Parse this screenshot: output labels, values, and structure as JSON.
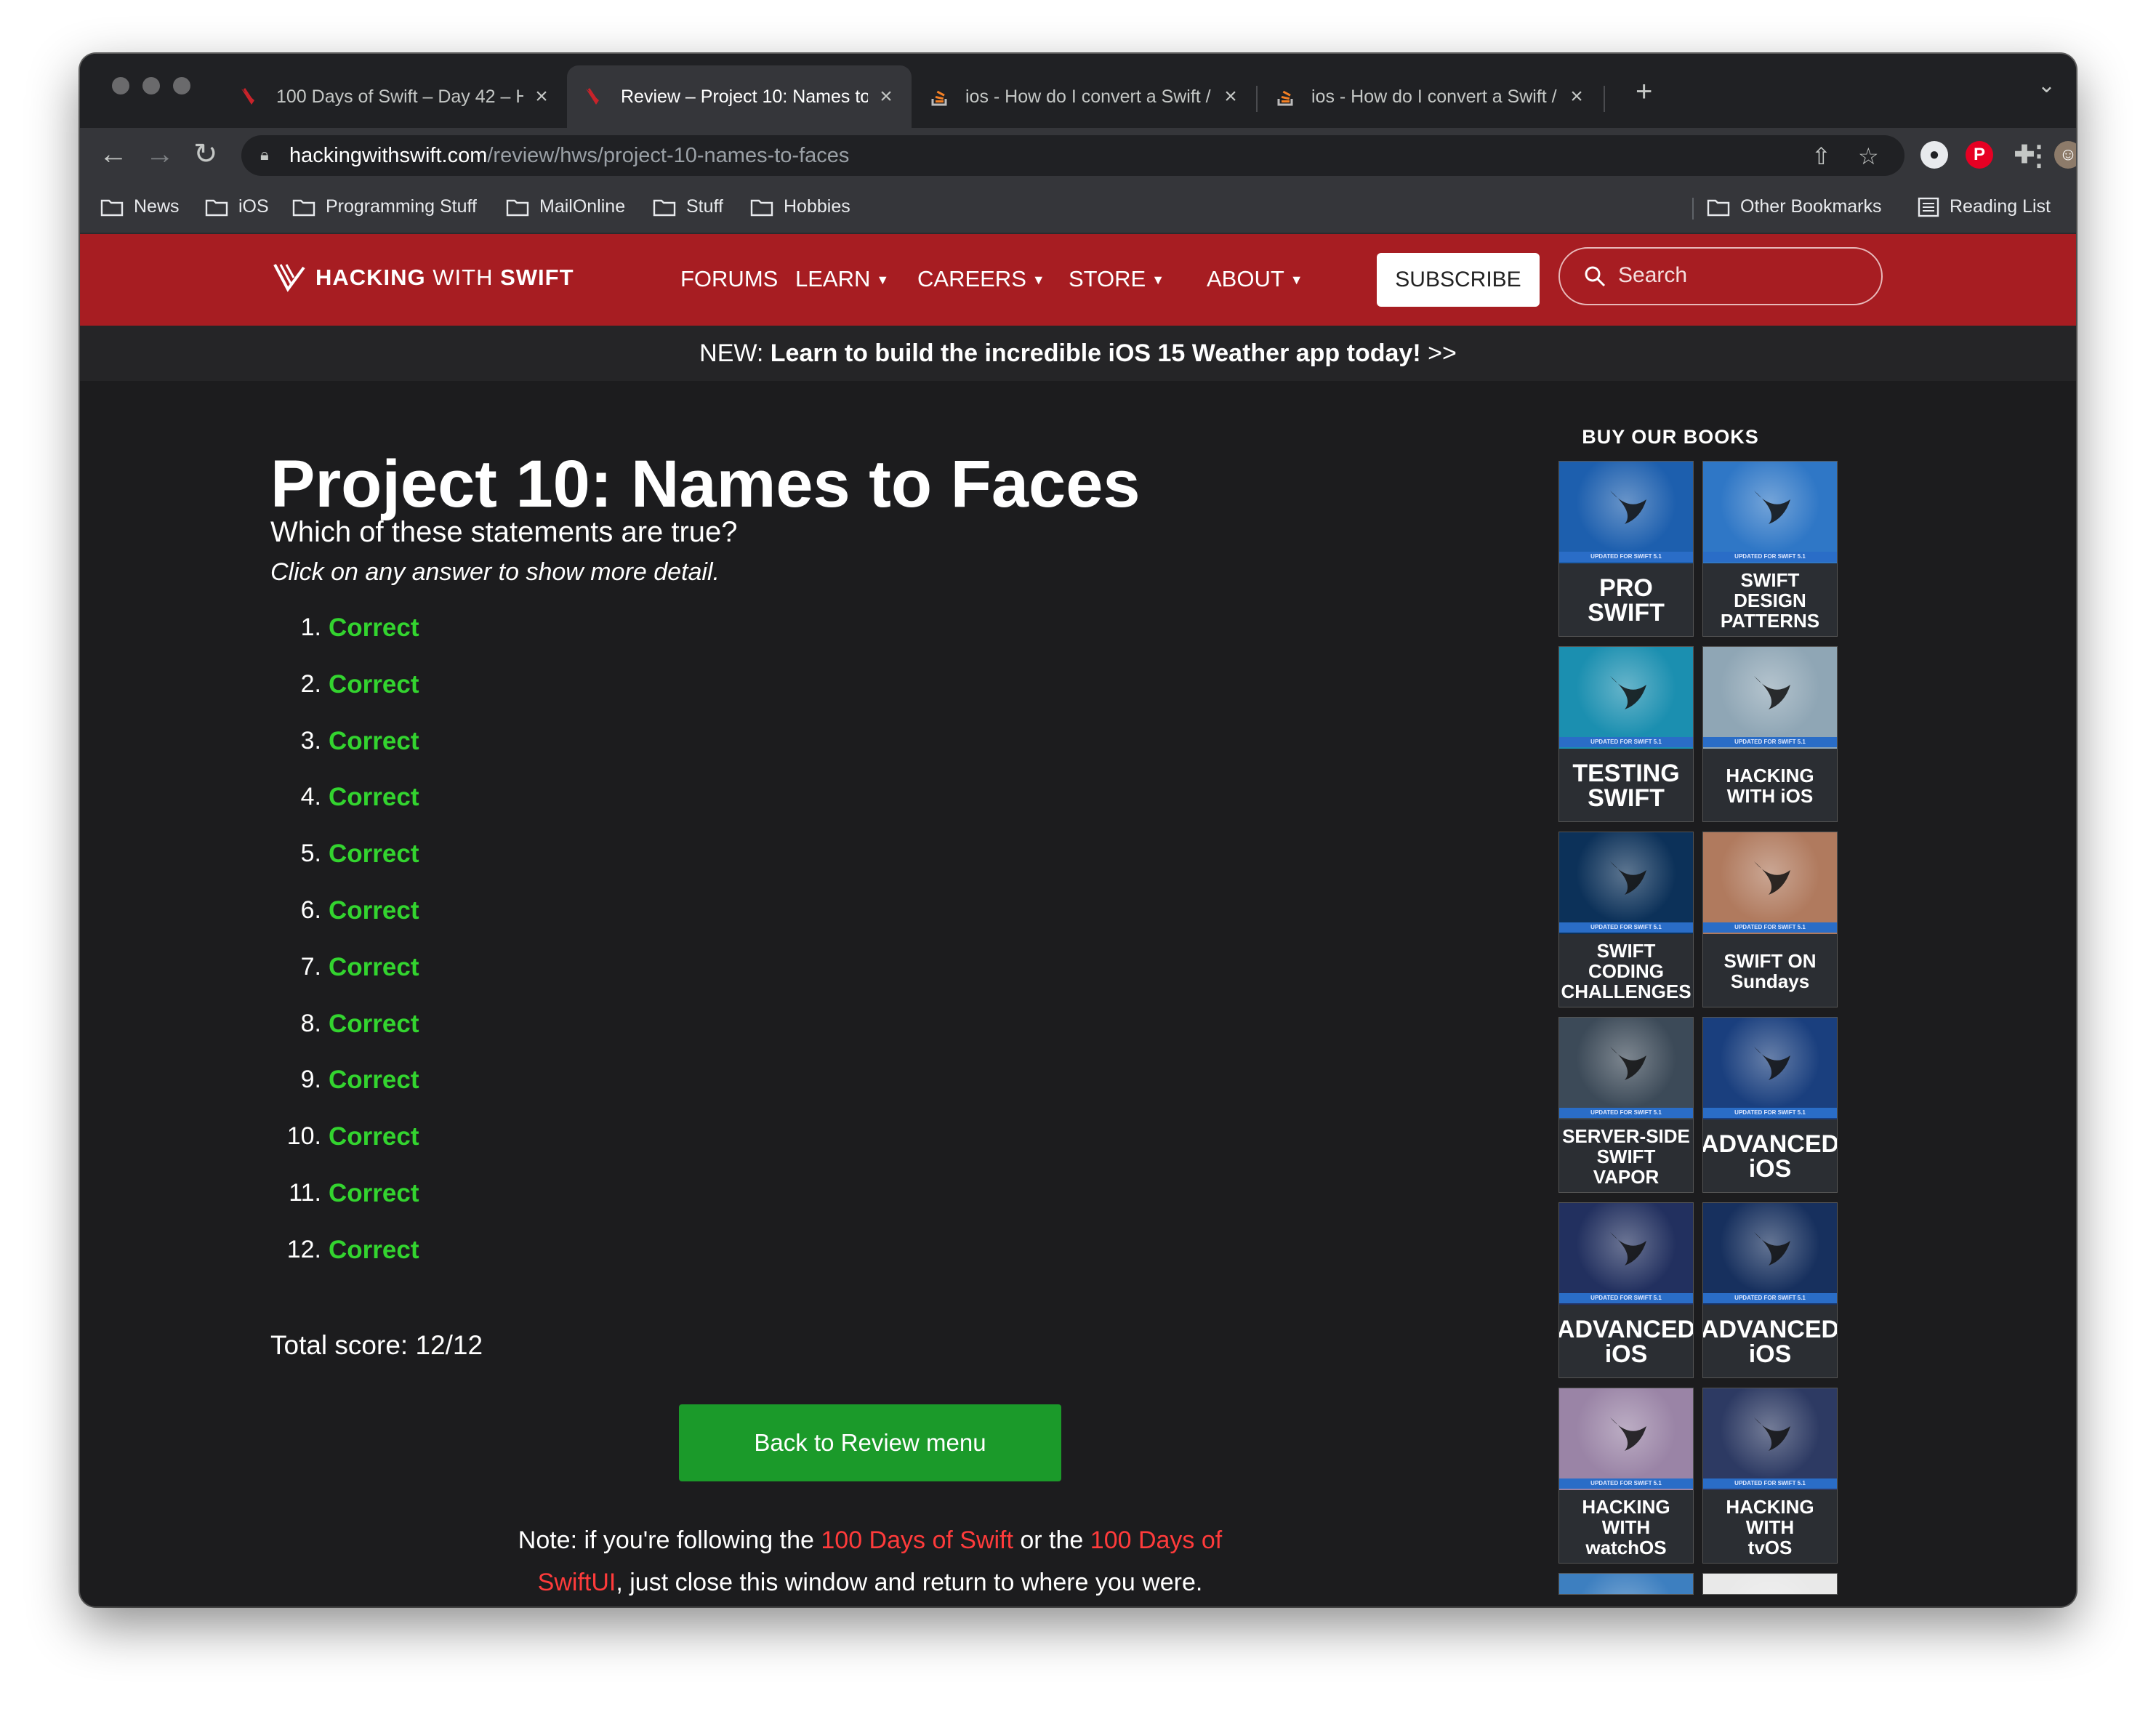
{
  "browser": {
    "tabs": [
      {
        "title": "100 Days of Swift – Day 42 – H",
        "favicon": "hws-logo-icon",
        "active": false
      },
      {
        "title": "Review – Project 10: Names to",
        "favicon": "hws-logo-icon",
        "active": true
      },
      {
        "title": "ios - How do I convert a Swift /",
        "favicon": "stackoverflow-icon",
        "active": false
      },
      {
        "title": "ios - How do I convert a Swift /",
        "favicon": "stackoverflow-icon",
        "active": false
      }
    ],
    "url_host": "hackingwithswift.com",
    "url_path": "/review/hws/project-10-names-to-faces",
    "bookmarks": [
      "News",
      "iOS",
      "Programming Stuff",
      "MailOnline",
      "Stuff",
      "Hobbies"
    ],
    "other_bookmarks": "Other Bookmarks",
    "reading_list": "Reading List"
  },
  "site": {
    "logo_bold": "HACKING",
    "logo_light": " WITH ",
    "logo_bold2": "SWIFT",
    "nav": [
      "FORUMS",
      "LEARN",
      "CAREERS",
      "STORE",
      "ABOUT"
    ],
    "subscribe": "SUBSCRIBE",
    "search_placeholder": "Search",
    "promo_prefix": "NEW: ",
    "promo_text": "Learn to build the incredible iOS 15 Weather app today!",
    "promo_suffix": " >>",
    "brand_color": "#a71d22",
    "correct_color": "#33d42f"
  },
  "review": {
    "title": "Project 10: Names to Faces",
    "question": "Which of these statements are true?",
    "hint": "Click on any answer to show more detail.",
    "answers": [
      {
        "num": "1.",
        "label": "Correct"
      },
      {
        "num": "2.",
        "label": "Correct"
      },
      {
        "num": "3.",
        "label": "Correct"
      },
      {
        "num": "4.",
        "label": "Correct"
      },
      {
        "num": "5.",
        "label": "Correct"
      },
      {
        "num": "6.",
        "label": "Correct"
      },
      {
        "num": "7.",
        "label": "Correct"
      },
      {
        "num": "8.",
        "label": "Correct"
      },
      {
        "num": "9.",
        "label": "Correct"
      },
      {
        "num": "10.",
        "label": "Correct"
      },
      {
        "num": "11.",
        "label": "Correct"
      },
      {
        "num": "12.",
        "label": "Correct"
      }
    ],
    "total_score": "Total score: 12/12",
    "back_button": "Back to Review menu",
    "note_1": "Note: if you're following the ",
    "note_link_1": "100 Days of Swift",
    "note_2": " or the ",
    "note_link_2": "100 Days of SwiftUI",
    "note_3": ", just close this window and return to where you were."
  },
  "books": {
    "heading": "BUY OUR BOOKS",
    "strip_text": "UPDATED FOR SWIFT 5.1",
    "items": [
      {
        "title": "PRO\nSWIFT",
        "art": "#1d5fae"
      },
      {
        "title": "SWIFT\nDESIGN\nPATTERNS",
        "art": "#2f77c6"
      },
      {
        "title": "TESTING\nSWIFT",
        "art": "#1b8fb0"
      },
      {
        "title": "HACKING\nWITH iOS",
        "art": "#8fa6b5"
      },
      {
        "title": "SWIFT\nCODING CHALLENGES",
        "art": "#0c3159"
      },
      {
        "title": "SWIFT ON\nSundays",
        "art": "#b07a5e"
      },
      {
        "title": "SERVER-SIDE SWIFT\nVAPOR",
        "art": "#3c4a58"
      },
      {
        "title": "ADVANCED\niOS",
        "art": "#1a3f7e"
      },
      {
        "title": "ADVANCED\niOS",
        "art": "#22305f"
      },
      {
        "title": "ADVANCED\niOS",
        "art": "#17305e"
      },
      {
        "title": "HACKING WITH\nwatchOS",
        "art": "#9a84a6"
      },
      {
        "title": "HACKING WITH\ntvOS",
        "art": "#2d3a63"
      },
      {
        "title": "",
        "art": "#3d7fc0"
      },
      {
        "title": "",
        "art": "#e9e9e9"
      }
    ]
  }
}
